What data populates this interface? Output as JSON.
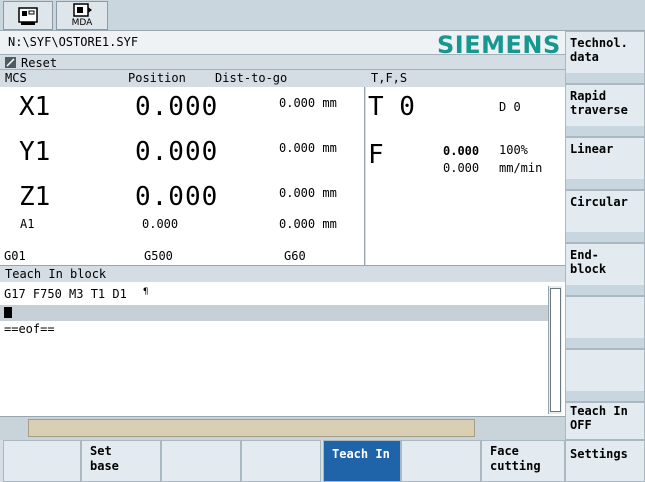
{
  "topbar": {
    "mda_label": "MDA"
  },
  "pathbar": {
    "path": "N:\\SYF\\OSTORE1.SYF",
    "brand": "SIEMENS",
    "brand_color": "#16978f"
  },
  "status": {
    "reset": "Reset"
  },
  "mcs": {
    "header": {
      "mcs": "MCS",
      "position": "Position",
      "dtg": "Dist-to-go"
    },
    "axes": [
      {
        "name": "X1",
        "position": "0.000",
        "dtg": "0.000 mm"
      },
      {
        "name": "Y1",
        "position": "0.000",
        "dtg": "0.000 mm"
      },
      {
        "name": "Z1",
        "position": "0.000",
        "dtg": "0.000 mm"
      }
    ],
    "aux_axis": {
      "name": "A1",
      "position": "0.000",
      "dtg": "0.000 mm"
    },
    "gcodes": [
      "G01",
      "G500",
      "G60"
    ]
  },
  "tfs": {
    "header": "T,F,S",
    "tool": "T 0",
    "d": "D  0",
    "feed_label": "F",
    "feed_actual": "0.000",
    "feed_set": "0.000",
    "override": "100%",
    "unit": "mm/min"
  },
  "teach": {
    "header": "Teach In block",
    "line1": "G17 F750 M3 T1 D1",
    "line3": "==eof=="
  },
  "right_softkeys": [
    {
      "line1": "Technol.",
      "line2": "data"
    },
    {
      "line1": "Rapid",
      "line2": "traverse"
    },
    {
      "line1": "Linear",
      "line2": ""
    },
    {
      "line1": "Circular",
      "line2": ""
    },
    {
      "line1": "End-",
      "line2": "block"
    },
    {
      "line1": "",
      "line2": ""
    },
    {
      "line1": "",
      "line2": ""
    },
    {
      "line1": "Teach In",
      "line2": "OFF"
    },
    {
      "line1": "Settings",
      "line2": ""
    }
  ],
  "bottom_softkeys": [
    {
      "line1": "",
      "line2": ""
    },
    {
      "line1": "Set",
      "line2": "base"
    },
    {
      "line1": "",
      "line2": ""
    },
    {
      "line1": "",
      "line2": ""
    },
    {
      "line1": "Teach In",
      "line2": ""
    },
    {
      "line1": "",
      "line2": ""
    },
    {
      "line1": "Face",
      "line2": "cutting"
    }
  ]
}
